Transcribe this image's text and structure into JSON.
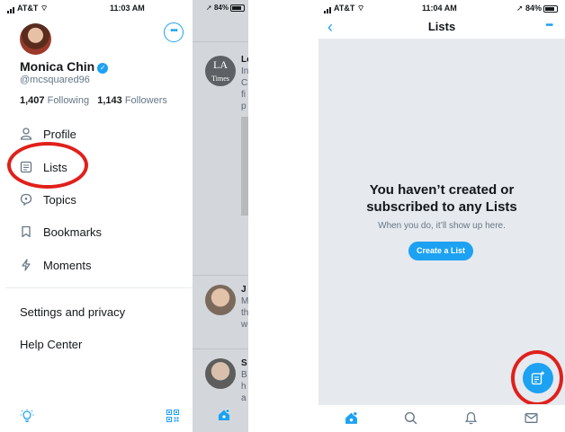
{
  "left_screen": {
    "status": {
      "carrier": "AT&T",
      "time": "11:03 AM",
      "battery": "84%"
    },
    "profile": {
      "name": "Monica Chin",
      "handle": "@mcsquared96",
      "following_count": "1,407",
      "following_label": "Following",
      "followers_count": "1,143",
      "followers_label": "Followers"
    },
    "menu": [
      {
        "label": "Profile",
        "icon": "person-icon"
      },
      {
        "label": "Lists",
        "icon": "list-icon"
      },
      {
        "label": "Topics",
        "icon": "topics-icon"
      },
      {
        "label": "Bookmarks",
        "icon": "bookmark-icon"
      },
      {
        "label": "Moments",
        "icon": "lightning-icon"
      }
    ],
    "secondary": [
      {
        "label": "Settings and privacy"
      },
      {
        "label": "Help Center"
      }
    ],
    "timeline_peek": {
      "status_battery": "84%",
      "item1_lines": [
        "Lo",
        "In",
        "C",
        "fi",
        "p"
      ],
      "item2_lines": [
        "J",
        "M",
        "th",
        "w"
      ],
      "item3_lines": [
        "S",
        "B",
        "h",
        "a"
      ]
    }
  },
  "right_screen": {
    "status": {
      "carrier": "AT&T",
      "time": "11:04 AM",
      "battery": "84%"
    },
    "title": "Lists",
    "empty_title_line1": "You haven’t created or",
    "empty_title_line2": "subscribed to any Lists",
    "empty_subtitle": "When you do, it’ll show up here.",
    "create_button": "Create a List",
    "tabs": [
      "home-icon",
      "search-icon",
      "notifications-icon",
      "messages-icon"
    ]
  },
  "colors": {
    "accent": "#1da1f2",
    "annotation": "#e0201b",
    "empty_bg": "#e6e9ee"
  }
}
